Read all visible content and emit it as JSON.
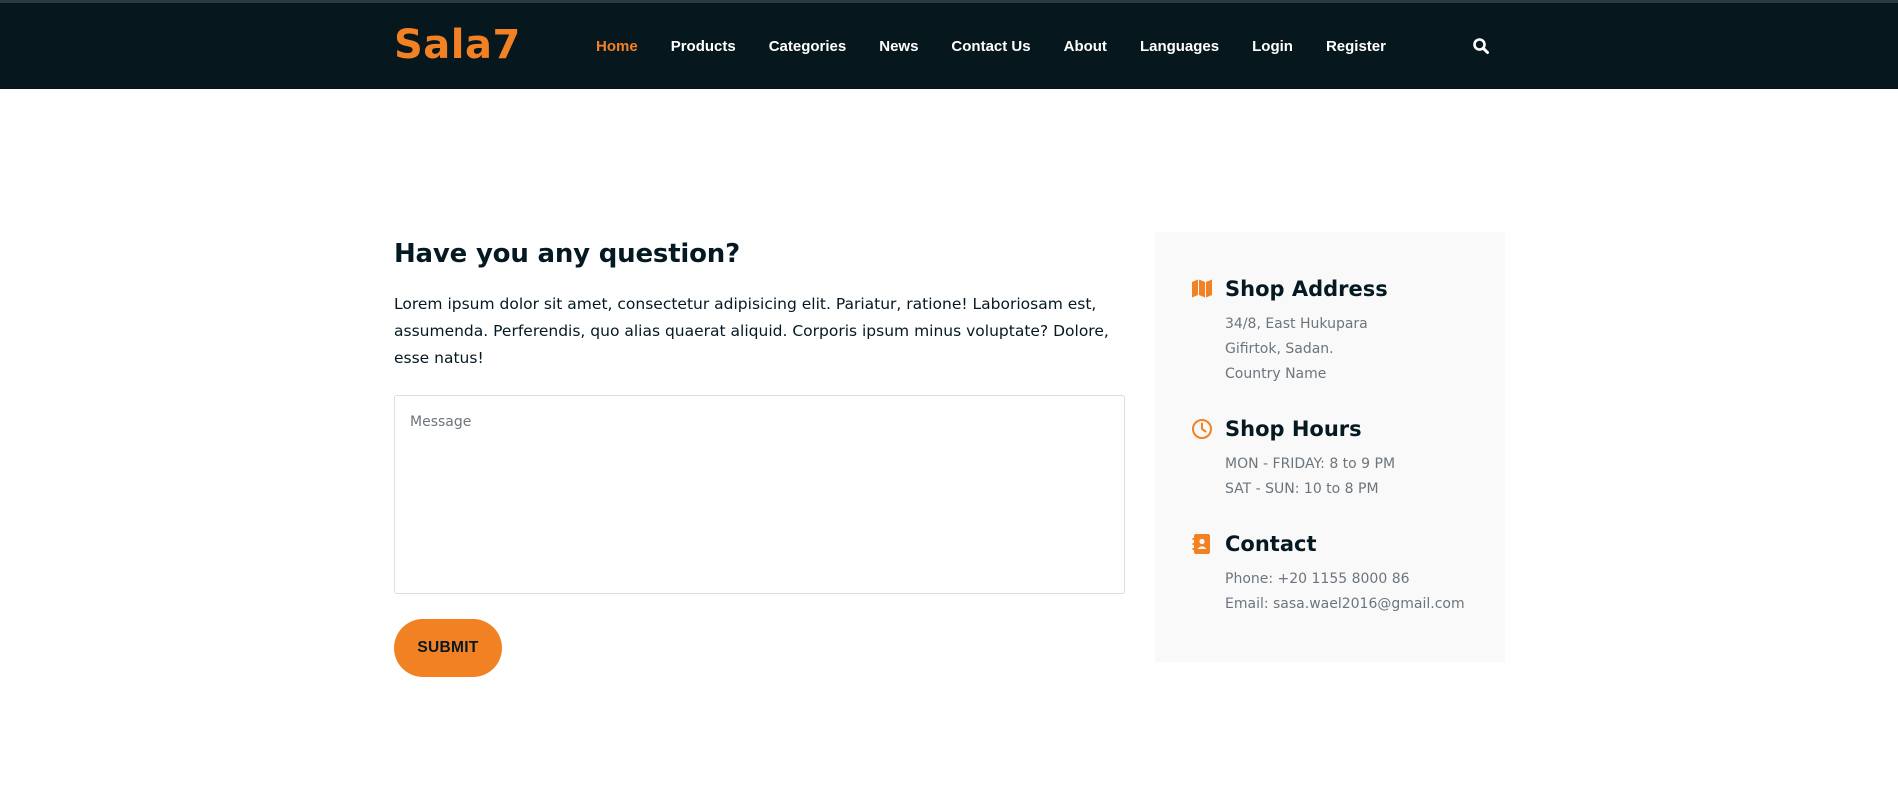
{
  "header": {
    "logo": "Sala7",
    "nav": [
      {
        "label": "Home",
        "active": true
      },
      {
        "label": "Products",
        "active": false
      },
      {
        "label": "Categories",
        "active": false
      },
      {
        "label": "News",
        "active": false
      },
      {
        "label": "Contact Us",
        "active": false
      },
      {
        "label": "About",
        "active": false
      },
      {
        "label": "Languages",
        "active": false
      },
      {
        "label": "Login",
        "active": false
      },
      {
        "label": "Register",
        "active": false
      }
    ],
    "search_icon": "search-icon"
  },
  "form": {
    "heading": "Have you any question?",
    "lead": "Lorem ipsum dolor sit amet, consectetur adipisicing elit. Pariatur, ratione! Laboriosam est, assumenda. Perferendis, quo alias quaerat aliquid. Corporis ipsum minus voluptate? Dolore, esse natus!",
    "message_placeholder": "Message",
    "message_value": "",
    "submit_label": "SUBMIT"
  },
  "info": {
    "address": {
      "title": "Shop Address",
      "icon": "map-icon",
      "lines": [
        "34/8, East Hukupara",
        "Gifirtok, Sadan.",
        "Country Name"
      ]
    },
    "hours": {
      "title": "Shop Hours",
      "icon": "clock-icon",
      "lines": [
        "MON - FRIDAY: 8 to 9 PM",
        "SAT - SUN: 10 to 8 PM"
      ]
    },
    "contact": {
      "title": "Contact",
      "icon": "address-book-icon",
      "lines": [
        "Phone: +20 1155 8000 86",
        "Email: sasa.wael2016@gmail.com"
      ]
    }
  },
  "colors": {
    "accent": "#f28123",
    "header_bg": "#07171e",
    "heading": "#051922",
    "muted": "#6c757d",
    "info_bg": "#f9f9f9"
  }
}
